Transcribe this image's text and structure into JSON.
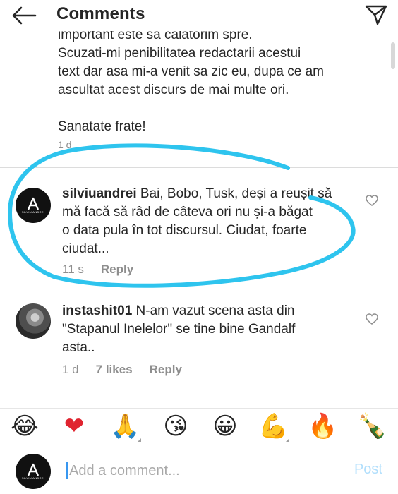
{
  "header": {
    "title": "Comments"
  },
  "caption": {
    "lines": [
      "important este sa calatorim spre.",
      "Scuzati-mi penibilitatea redactarii acestui",
      "text dar asa mi-a venit sa zic eu, dupa ce am",
      "ascultat acest discurs de mai multe ori."
    ],
    "closing": "Sanatate frate!",
    "time": "1 d"
  },
  "comments": [
    {
      "username": "silviuandrei",
      "lines": [
        " Bai, Bobo, Tusk, deși a reușit să",
        "mă facă să râd de câteva ori nu și-a băgat",
        "o data pula în tot discursul. Ciudat, foarte",
        "ciudat..."
      ],
      "time": "11 s",
      "reply": "Reply",
      "avatar_text": "SILVIU ANDREI"
    },
    {
      "username": "instashit01",
      "lines": [
        " N-am vazut scena asta din",
        "\"Stapanul Inelelor\" se tine bine Gandalf",
        "asta.."
      ],
      "time": "1 d",
      "likes": "7 likes",
      "reply": "Reply"
    }
  ],
  "emoji_bar": {
    "items": [
      {
        "name": "laughing-tears",
        "glyph": "😂"
      },
      {
        "name": "red-heart",
        "glyph": "❤"
      },
      {
        "name": "praying-hands",
        "glyph": "🙏"
      },
      {
        "name": "kissing-face",
        "glyph": "😘"
      },
      {
        "name": "smiling-face",
        "glyph": "😀"
      },
      {
        "name": "flexed-biceps",
        "glyph": "💪"
      },
      {
        "name": "fire",
        "glyph": "🔥"
      },
      {
        "name": "champagne",
        "glyph": "🍾"
      }
    ]
  },
  "composer": {
    "placeholder": "Add a comment...",
    "post_label": "Post",
    "avatar_text": "SILVIU ANDREI"
  },
  "colors": {
    "annotation": "#2ec4ee",
    "muted": "#8e8e8e",
    "post_disabled": "#b2dffc",
    "text": "#262626"
  }
}
